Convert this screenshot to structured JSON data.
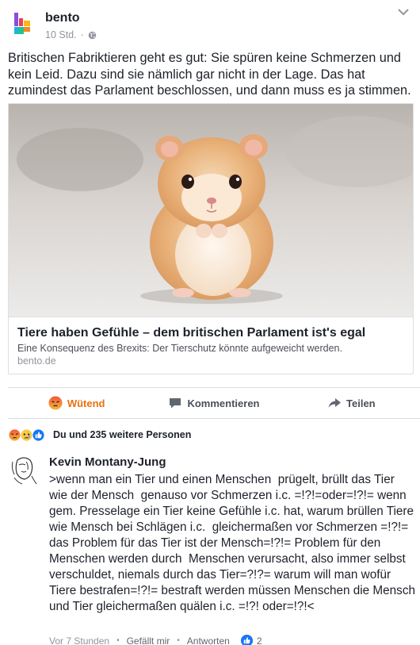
{
  "post": {
    "page_name": "bento",
    "time": "10 Std.",
    "separator": "·",
    "text": "Britischen Fabriktieren geht es gut: Sie spüren keine Schmerzen und kein Leid. Dazu sind sie nämlich gar nicht in der Lage. Das hat zumindest das Parlament beschlossen, und dann muss es ja stimmen."
  },
  "link": {
    "title": "Tiere haben Gefühle – dem britischen Parlament ist's egal",
    "description": "Eine Konsequenz des Brexits: Der Tierschutz könnte aufgeweicht werden.",
    "domain": "bento.de"
  },
  "actions": {
    "react_label": "Wütend",
    "comment_label": "Kommentieren",
    "share_label": "Teilen"
  },
  "reactions": {
    "summary": "Du und 235 weitere Personen"
  },
  "comment": {
    "author": "Kevin Montany-Jung",
    "text": ">wenn man ein Tier und einen Menschen  prügelt, brüllt das Tier wie der Mensch  genauso vor Schmerzen i.c. =!?!=oder=!?!= wenn gem. Presselage ein Tier keine Gefühle i.c. hat, warum brüllen Tiere  wie Mensch bei Schlägen i.c.  gleichermaßen vor Schmerzen =!?!= das Problem für das Tier ist der Mensch=!?!= Problem für den  Menschen werden durch  Menschen verursacht, also immer selbst verschuldet, niemals durch das Tier=?!?= warum will man wofür Tiere bestrafen=!?!= bestraft werden müssen Menschen die Mensch und Tier gleichermaßen quälen i.c. =!?! oder=!?!<",
    "time": "Vor 7 Stunden",
    "like_label": "Gefällt mir",
    "reply_label": "Antworten",
    "like_count": "2",
    "dot": "•"
  },
  "colors": {
    "angry": "#e9710f",
    "like_blue": "#1877f2",
    "muted": "#90949c"
  },
  "icons": [
    "bento-logo",
    "globe-icon",
    "chevron-down-icon",
    "angry-reaction-icon",
    "comment-icon",
    "share-icon",
    "sad-reaction-icon",
    "like-reaction-icon",
    "avatar-sketch"
  ]
}
